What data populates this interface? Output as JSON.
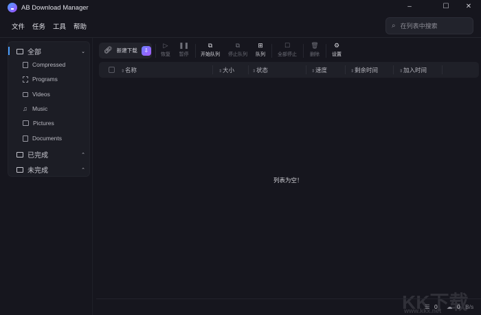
{
  "window": {
    "title": "AB Download Manager",
    "minimize": "–",
    "maximize": "☐",
    "close": "✕"
  },
  "menu": [
    "文件",
    "任务",
    "工具",
    "帮助"
  ],
  "search": {
    "placeholder": "在列表中搜索"
  },
  "sidebar": {
    "all": "全部",
    "categories": [
      "Compressed",
      "Programs",
      "Videos",
      "Music",
      "Pictures",
      "Documents"
    ],
    "finished": "已完成",
    "unfinished": "未完成"
  },
  "toolbar": {
    "new_download": "新建下载",
    "resume": "恢复",
    "pause": "暂停",
    "start_queue": "开始队列",
    "stop_queue": "停止队列",
    "queue": "队列",
    "stop_all": "全部停止",
    "delete": "删除",
    "settings": "设置"
  },
  "table": {
    "columns": [
      "名称",
      "大小",
      "状态",
      "速度",
      "剩余时间",
      "加入时间"
    ],
    "empty_message": "列表为空！"
  },
  "status": {
    "active_count": "0",
    "speed": "0",
    "speed_unit": "B/s"
  },
  "watermark": {
    "logo": "KK下载",
    "url": "www.kkx.net"
  }
}
